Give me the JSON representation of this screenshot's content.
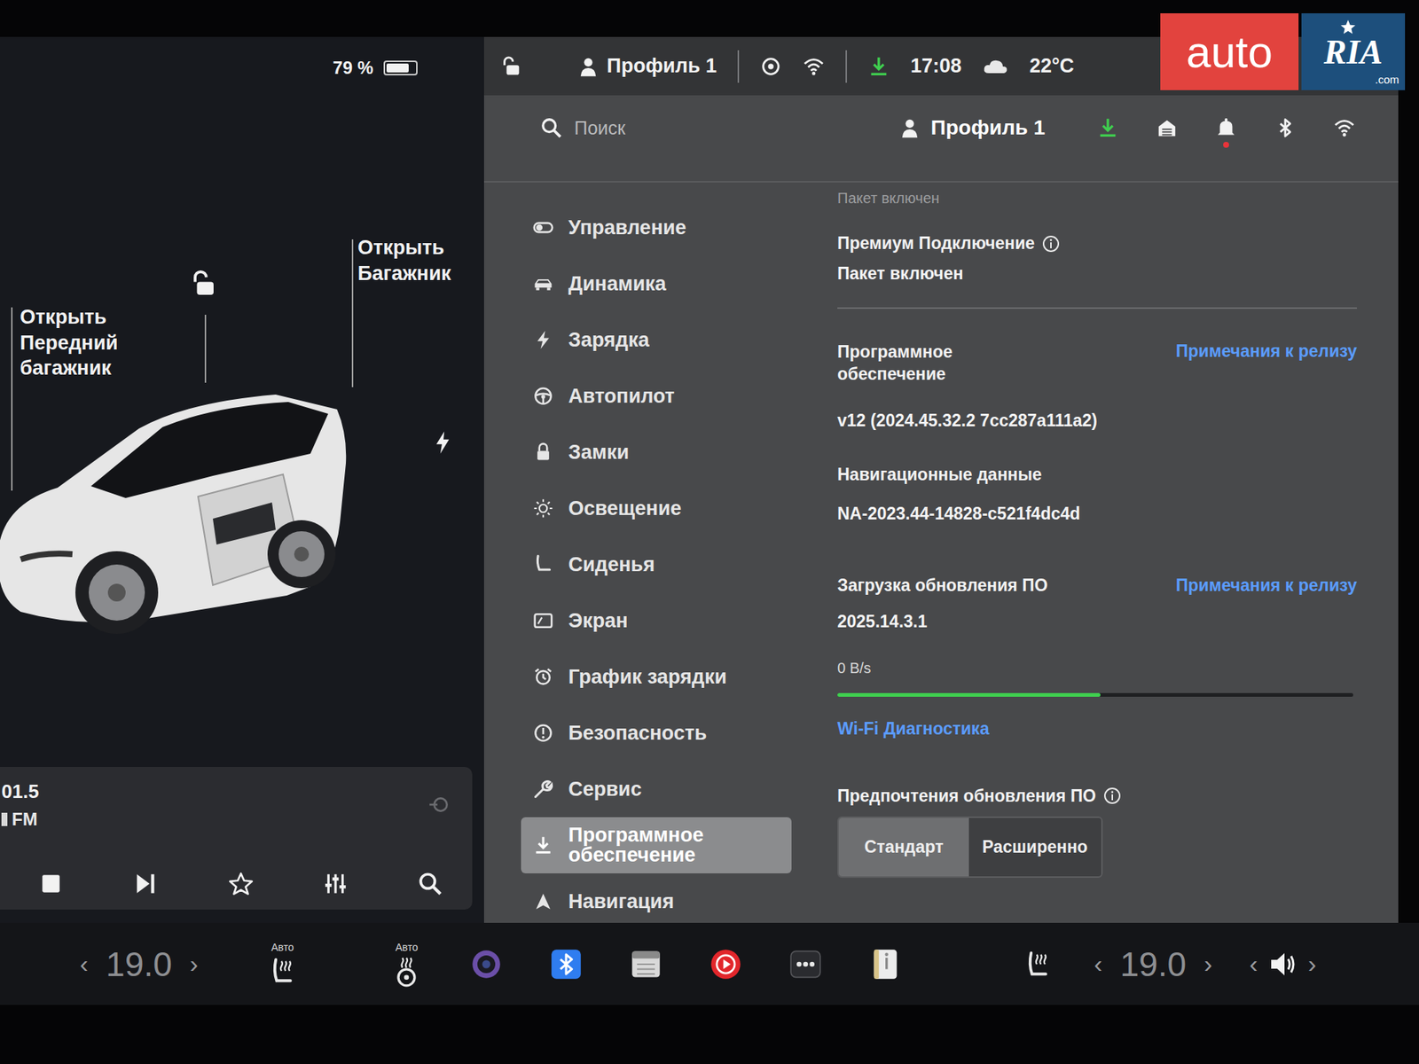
{
  "watermark": {
    "brand": "auto",
    "mark": "RIA",
    "domain": ".com"
  },
  "left_panel": {
    "battery": {
      "reading": "79 %",
      "level": 0.79
    },
    "front_trunk_label": {
      "lines": [
        "Открыть",
        "Передний",
        "багажник"
      ]
    },
    "trunk_label": {
      "lines": [
        "Открыть",
        "Багажник"
      ]
    },
    "media": {
      "frequency": "01.5",
      "band": "FM"
    }
  },
  "status_bar": {
    "profile": "Профиль 1",
    "time": "17:08",
    "temperature": "22°C"
  },
  "header": {
    "search_placeholder": "Поиск",
    "profile": "Профиль 1",
    "has_notification": true
  },
  "sidebar": {
    "items": [
      {
        "label": "Управление",
        "selected": false
      },
      {
        "label": "Динамика",
        "selected": false
      },
      {
        "label": "Зарядка",
        "selected": false
      },
      {
        "label": "Автопилот",
        "selected": false
      },
      {
        "label": "Замки",
        "selected": false
      },
      {
        "label": "Освещение",
        "selected": false
      },
      {
        "label": "Сиденья",
        "selected": false
      },
      {
        "label": "Экран",
        "selected": false
      },
      {
        "label": "График зарядки",
        "selected": false
      },
      {
        "label": "Безопасность",
        "selected": false
      },
      {
        "label": "Сервис",
        "selected": false
      },
      {
        "label": "Программное обеспечение",
        "selected": true
      },
      {
        "label": "Навигация",
        "selected": false
      }
    ]
  },
  "content": {
    "faded_note": "Пакет включен",
    "premium": {
      "title": "Премиум Подключение",
      "value": "Пакет включен"
    },
    "software": {
      "title": "Программное обеспечение",
      "link": "Примечания к релизу",
      "version": "v12 (2024.45.32.2 7cc287a111a2)"
    },
    "nav_data": {
      "title": "Навигационные данные",
      "value": "NA-2023.44-14828-c521f4dc4d"
    },
    "update": {
      "title": "Загрузка обновления ПО",
      "link": "Примечания к релизу",
      "version": "2025.14.3.1",
      "speed": "0 B/s",
      "level": 0.51
    },
    "wifi_link": "Wi-Fi Диагностика",
    "preferences": {
      "title": "Предпочтения обновления ПО",
      "options": [
        {
          "label": "Стандарт",
          "selected": true
        },
        {
          "label": "Расширенно",
          "selected": false
        }
      ]
    }
  },
  "dock": {
    "left_climate": {
      "dec": "‹",
      "value": "19.0",
      "inc": "›"
    },
    "seat_heat_left": {
      "label": "Авто"
    },
    "wheel_heat": {
      "label": "Авто"
    },
    "right_climate": {
      "dec": "‹",
      "value": "19.0",
      "inc": "›"
    },
    "volume": {
      "dec": "‹",
      "inc": "›"
    }
  }
}
